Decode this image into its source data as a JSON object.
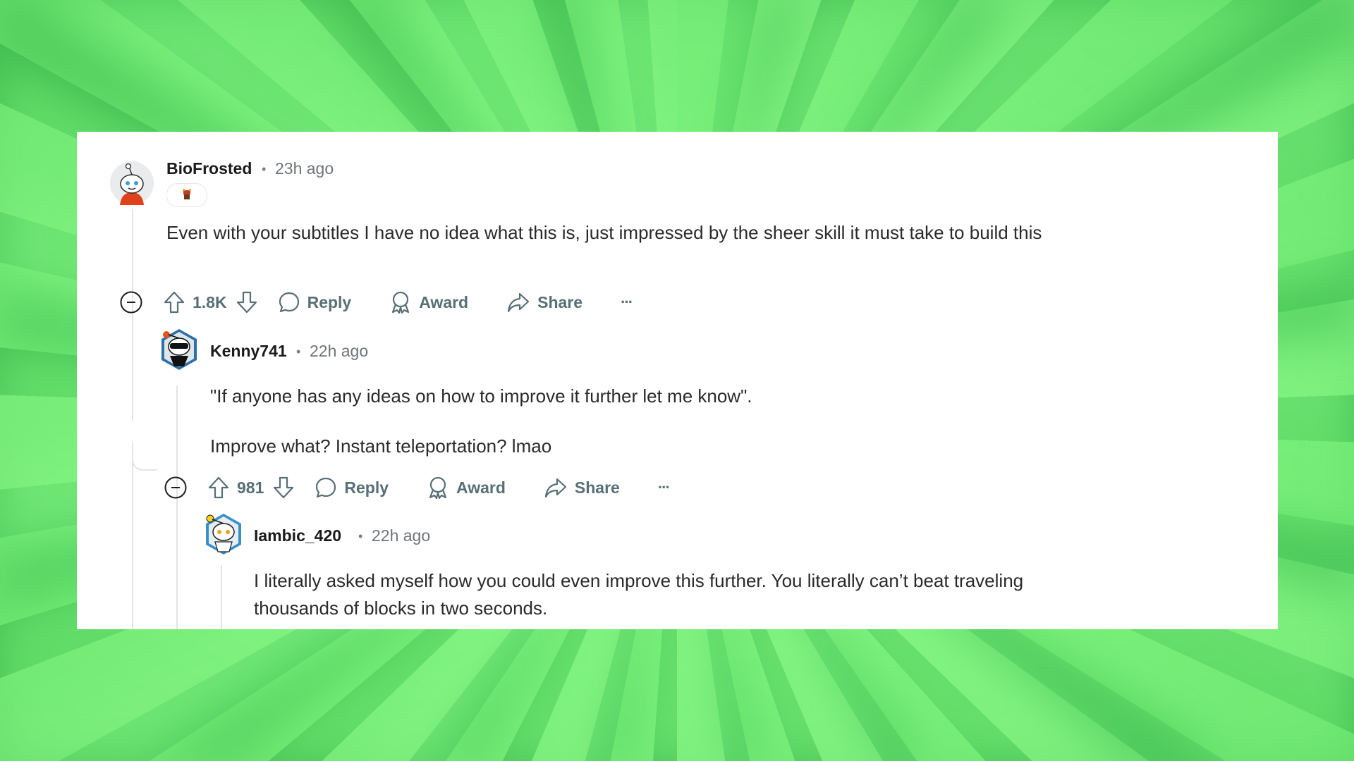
{
  "comments": [
    {
      "username": "BioFrosted",
      "separator": "•",
      "time": "23h ago",
      "body": "Even with your subtitles I have no idea what this is, just impressed by the sheer skill it must take to build this",
      "votes": "1.8K",
      "reply_label": "Reply",
      "award_label": "Award",
      "share_label": "Share",
      "more_label": "···"
    },
    {
      "username": "Kenny741",
      "separator": "•",
      "time": "22h ago",
      "body_line1": "\"If anyone has any ideas on how to improve it further let me know\".",
      "body_line2": "Improve what? Instant teleportation? lmao",
      "votes": "981",
      "reply_label": "Reply",
      "award_label": "Award",
      "share_label": "Share",
      "more_label": "···"
    },
    {
      "username": "Iambic_420",
      "separator": "•",
      "time": "22h ago",
      "body": "I literally asked myself how you could even improve this further. You literally can’t beat traveling thousands of blocks in two seconds."
    }
  ],
  "colors": {
    "background_green": "#7ef27e",
    "card": "#ffffff",
    "action_text": "#576f76",
    "thread_line": "#e2e4e6"
  }
}
